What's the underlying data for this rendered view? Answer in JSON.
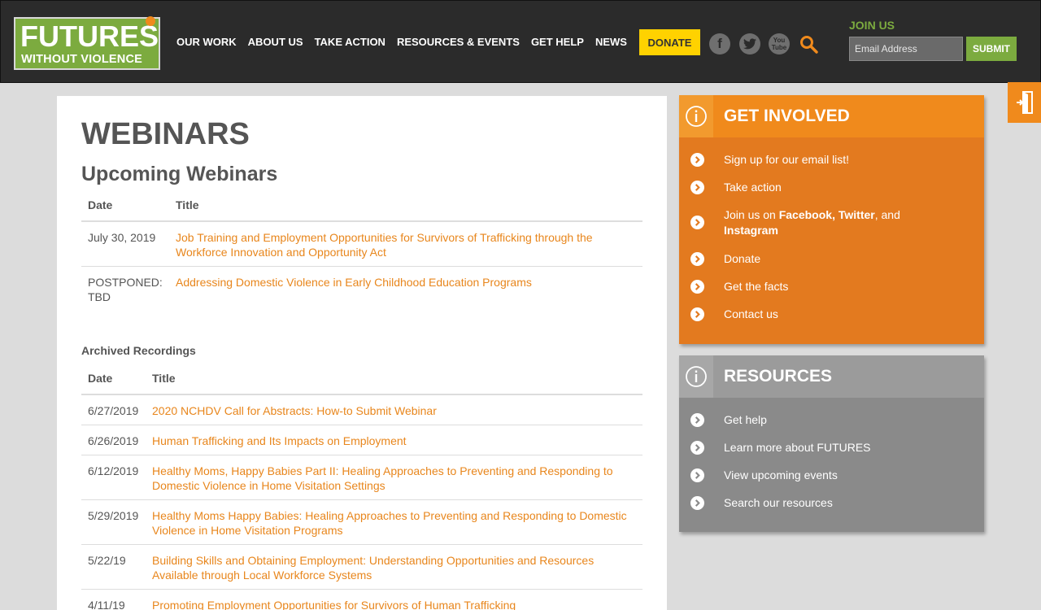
{
  "header": {
    "logo_line1": "FUTURES",
    "logo_line2": "WITHOUT VIOLENCE",
    "nav": [
      "OUR WORK",
      "ABOUT US",
      "TAKE ACTION",
      "RESOURCES & EVENTS",
      "GET HELP",
      "NEWS"
    ],
    "donate": "DONATE",
    "social": {
      "facebook": "f",
      "youtube_top": "You",
      "youtube_bottom": "Tube"
    },
    "join_label": "JOIN US",
    "email_placeholder": "Email Address",
    "submit": "SUBMIT"
  },
  "colors": {
    "accent_orange": "#e8861c",
    "brand_green": "#7cab3f",
    "header_bg": "#2b2b2b",
    "donate_yellow": "#ffd200"
  },
  "main": {
    "title": "WEBINARS",
    "upcoming_heading": "Upcoming Webinars",
    "upcoming_cols": [
      "Date",
      "Title"
    ],
    "upcoming": [
      {
        "date": "July 30, 2019",
        "title": "Job Training and Employment Opportunities for Survivors of Trafficking through the Workforce Innovation and Opportunity Act"
      },
      {
        "date": "POSTPONED: TBD",
        "title": "Addressing Domestic Violence in Early Childhood Education Programs"
      }
    ],
    "archived_heading": "Archived Recordings",
    "archived_cols": [
      "Date",
      "Title"
    ],
    "archived": [
      {
        "date": "6/27/2019",
        "title": "2020 NCHDV Call for Abstracts: How-to Submit Webinar"
      },
      {
        "date": "6/26/2019",
        "title": "Human Trafficking and Its Impacts on Employment"
      },
      {
        "date": "6/12/2019",
        "title": "Healthy Moms, Happy Babies Part II: Healing Approaches to Preventing and Responding to Domestic Violence in Home Visitation Settings"
      },
      {
        "date": "5/29/2019",
        "title": "Healthy Moms Happy Babies: Healing Approaches to Preventing and Responding to Domestic Violence in Home Visitation Programs"
      },
      {
        "date": "5/22/19",
        "title": "Building Skills and Obtaining Employment: Understanding Opportunities and Resources Available through Local Workforce Systems"
      },
      {
        "date": "4/11/19",
        "title": "Promoting Employment Opportunities for Survivors of Human Trafficking"
      }
    ]
  },
  "sidebar": {
    "involved_title": "GET INVOLVED",
    "involved_items": [
      "Sign up for our email list!",
      "Take action",
      "Join us on",
      "Donate",
      "Get the facts",
      "Contact us"
    ],
    "join_parts": {
      "facebook": "Facebook,",
      "twitter": "Twitter",
      "and": ", and",
      "instagram": "Instagram"
    },
    "resources_title": "RESOURCES",
    "resources_items": [
      "Get help",
      "Learn more about FUTURES",
      "View upcoming events",
      "Search our resources"
    ]
  }
}
